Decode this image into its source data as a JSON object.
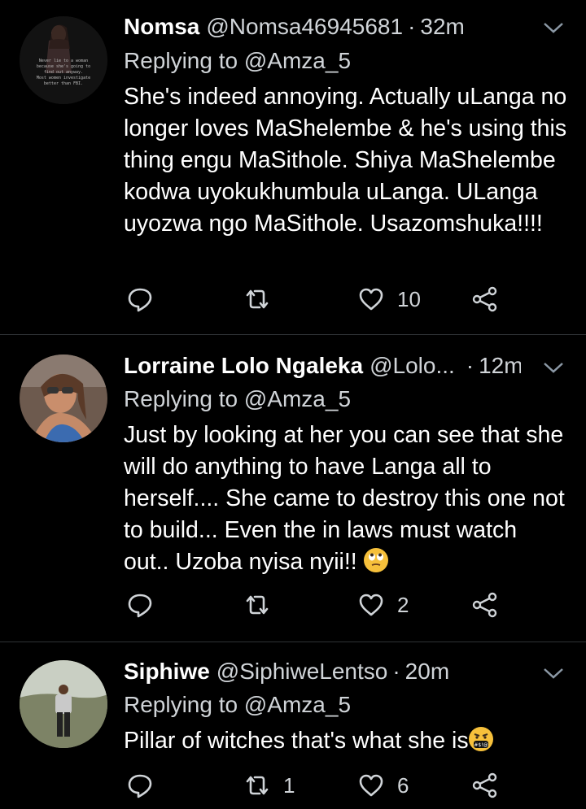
{
  "tweets": [
    {
      "name": "Nomsa",
      "handle": "@Nomsa46945681",
      "time": "32m",
      "replying_prefix": "Replying to",
      "replying_to": "@Amza_5",
      "avatar_text": "Never lie to a woman because she's going to find out anyway. Most women investigate better than FBI.",
      "text": "She's indeed annoying. Actually uLanga no longer loves MaShelembe & he's using this thing engu MaSithole. Shiya MaShelembe kodwa uyokukhumbula uLanga. ULanga uyozwa ngo MaSithole. Usazomshuka!!!!",
      "reply_count": "",
      "retweet_count": "",
      "like_count": "10"
    },
    {
      "name": "Lorraine Lolo Ngaleka",
      "handle": "@Lolo...",
      "time": "12m",
      "replying_prefix": "Replying to",
      "replying_to": "@Amza_5",
      "text": "Just by looking at her you can see that she will do anything to have Langa all to herself.... She came to destroy this one not to build... Even the in laws must watch out.. Uzoba nyisa nyii!!",
      "emoji": "face-with-rolling-eyes",
      "reply_count": "",
      "retweet_count": "",
      "like_count": "2"
    },
    {
      "name": "Siphiwe",
      "handle": "@SiphiweLentso",
      "time": "20m",
      "replying_prefix": "Replying to",
      "replying_to": "@Amza_5",
      "text": "Pillar of witches that's what she is",
      "emoji": "face-with-symbols-on-mouth",
      "reply_count": "",
      "retweet_count": "1",
      "like_count": "6"
    }
  ],
  "colors": {
    "background": "#000000",
    "text": "#ffffff",
    "muted": "#d0d4d8",
    "divider": "#2f3336",
    "emoji": "#f6c03b"
  }
}
